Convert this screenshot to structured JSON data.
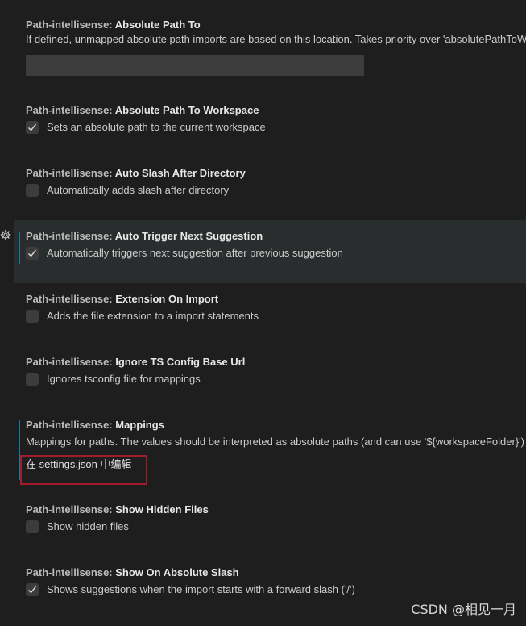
{
  "settings": [
    {
      "category": "Path-intellisense: ",
      "key": "Absolute Path To",
      "description": "If defined, unmapped absolute path imports are based on this location. Takes priority over 'absolutePathToW",
      "type": "string",
      "value": ""
    },
    {
      "category": "Path-intellisense: ",
      "key": "Absolute Path To Workspace",
      "description": "Sets an absolute path to the current workspace",
      "type": "boolean",
      "checked": true
    },
    {
      "category": "Path-intellisense: ",
      "key": "Auto Slash After Directory",
      "description": "Automatically adds slash after directory",
      "type": "boolean",
      "checked": false
    },
    {
      "category": "Path-intellisense: ",
      "key": "Auto Trigger Next Suggestion",
      "description": "Automatically triggers next suggestion after previous suggestion",
      "type": "boolean",
      "checked": true
    },
    {
      "category": "Path-intellisense: ",
      "key": "Extension On Import",
      "description": "Adds the file extension to a import statements",
      "type": "boolean",
      "checked": false
    },
    {
      "category": "Path-intellisense: ",
      "key": "Ignore TS Config Base Url",
      "description": "Ignores tsconfig file for mappings",
      "type": "boolean",
      "checked": false
    },
    {
      "category": "Path-intellisense: ",
      "key": "Mappings",
      "description": "Mappings for paths. The values should be interpreted as absolute paths (and can use '${workspaceFolder}')",
      "type": "object",
      "link_label": "在 settings.json 中编辑"
    },
    {
      "category": "Path-intellisense: ",
      "key": "Show Hidden Files",
      "description": "Show hidden files",
      "type": "boolean",
      "checked": false
    },
    {
      "category": "Path-intellisense: ",
      "key": "Show On Absolute Slash",
      "description": "Shows suggestions when the import starts with a forward slash ('/')",
      "type": "boolean",
      "checked": true
    }
  ],
  "icons": {
    "gear": "gear-icon",
    "check": "check-icon"
  },
  "colors": {
    "background": "#1e1e1e",
    "focused_row": "#2a2d2e",
    "modified_indicator": "#0c7d9d",
    "highlight_box": "#a31c2c",
    "checkbox_bg": "#3c3c3c"
  },
  "watermark": "CSDN @相见一月"
}
